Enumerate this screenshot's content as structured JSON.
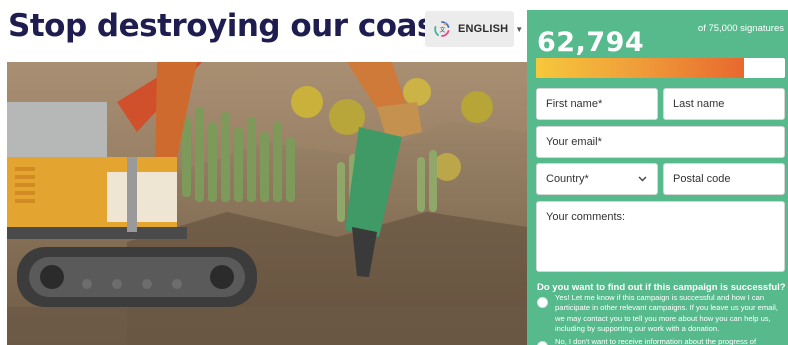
{
  "headline": "Stop destroying our coast!",
  "language": {
    "label": "ENGLISH",
    "icon": "language-globe-icon"
  },
  "photo": {
    "alt": "Excavator with hydraulic hammer breaking rock on a cactus-covered hillside"
  },
  "petition": {
    "count": "62,794",
    "goal_text": "of 75,000 signatures",
    "progress_fraction": 0.837,
    "colors": {
      "panel": "#56ba8d",
      "progress_start": "#f6c83b",
      "progress_end": "#e8682e"
    }
  },
  "form": {
    "first_name": "First name*",
    "last_name": "Last name",
    "email": "Your email*",
    "country": "Country*",
    "postal_code": "Postal code",
    "comments": "Your comments:"
  },
  "consent": {
    "question": "Do you want to find out if this campaign is successful? *",
    "option_yes": "Yes! Let me know if this campaign is successful and how I can participate in other relevant campaigns. If you leave us your email, we may contact you to tell you more about how you can help us, including by supporting our work with a donation.",
    "option_no": "No, I don't want to receive information about the progress of"
  }
}
